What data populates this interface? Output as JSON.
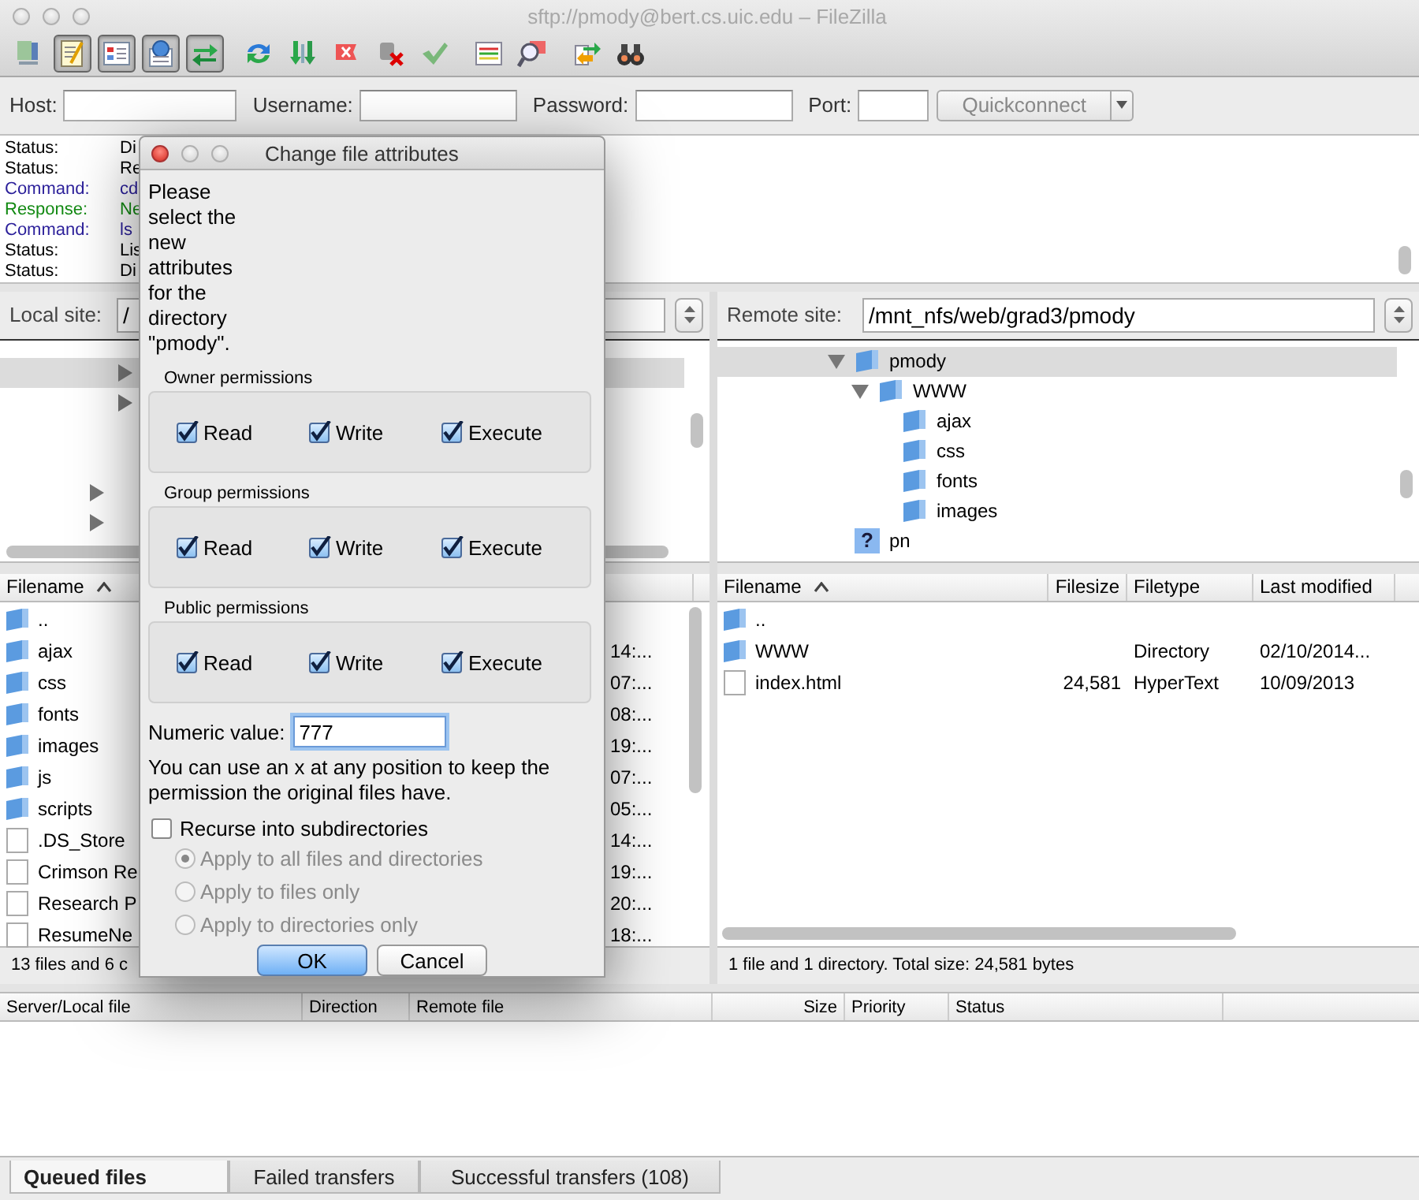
{
  "window": {
    "title": "sftp://pmody@bert.cs.uic.edu – FileZilla"
  },
  "toolbar": [
    {
      "kind": "site-manager",
      "on": false
    },
    {
      "kind": "message-log",
      "on": true
    },
    {
      "kind": "local-tree",
      "on": true
    },
    {
      "kind": "remote-tree",
      "on": true
    },
    {
      "kind": "transfer-queue",
      "on": true
    },
    {
      "kind": "refresh",
      "on": false
    },
    {
      "kind": "process-queue",
      "on": false
    },
    {
      "kind": "cancel",
      "on": false
    },
    {
      "kind": "disconnect",
      "on": false
    },
    {
      "kind": "reconnect",
      "on": false
    },
    {
      "kind": "filter",
      "on": false
    },
    {
      "kind": "compare",
      "on": false
    },
    {
      "kind": "sync",
      "on": false
    },
    {
      "kind": "find",
      "on": false
    }
  ],
  "quickconnect": {
    "fields": [
      {
        "kind": "host",
        "label": "Host:"
      },
      {
        "kind": "username",
        "label": "Username:"
      },
      {
        "kind": "password",
        "label": "Password:"
      },
      {
        "kind": "port",
        "label": "Port:"
      }
    ],
    "button": "Quickconnect"
  },
  "log": [
    {
      "kind": "status",
      "label": "Status:",
      "message": "Di"
    },
    {
      "kind": "status",
      "label": "Status:",
      "message": "Re"
    },
    {
      "kind": "command",
      "label": "Command:",
      "message": "cd"
    },
    {
      "kind": "response",
      "label": "Response:",
      "message": "Ne"
    },
    {
      "kind": "command",
      "label": "Command:",
      "message": "ls"
    },
    {
      "kind": "status",
      "label": "Status:",
      "message": "Lis"
    },
    {
      "kind": "status",
      "label": "Status:",
      "message": "Di"
    }
  ],
  "local": {
    "site_label": "Local site:",
    "path": "/",
    "tree": [
      {
        "expanded": false,
        "selected": true
      },
      {
        "expanded": false,
        "selected": false
      },
      {
        "expanded": false,
        "selected": false
      },
      {
        "expanded": false,
        "selected": false
      }
    ],
    "columns": [
      "Filename"
    ],
    "rows": [
      {
        "kind": "folder",
        "name": ".."
      },
      {
        "kind": "folder",
        "name": "ajax",
        "column_2": "14:..."
      },
      {
        "kind": "folder",
        "name": "css",
        "column_2": "07:..."
      },
      {
        "kind": "folder",
        "name": "fonts",
        "column_2": "08:..."
      },
      {
        "kind": "folder",
        "name": "images",
        "column_2": "19:..."
      },
      {
        "kind": "folder",
        "name": "js",
        "column_2": "07:..."
      },
      {
        "kind": "folder",
        "name": "scripts",
        "column_2": "05:..."
      },
      {
        "kind": "file",
        "name": ".DS_Store",
        "column_2": "14:..."
      },
      {
        "kind": "file",
        "name": "Crimson Re",
        "column_2": "19:..."
      },
      {
        "kind": "file",
        "name": "Research P",
        "column_2": "20:..."
      },
      {
        "kind": "file",
        "name": "ResumeNe",
        "column_2": "18:..."
      }
    ],
    "status": "13 files and 6 c"
  },
  "remote": {
    "site_label": "Remote site:",
    "path": "/mnt_nfs/web/grad3/pmody",
    "tree": [
      {
        "label": "pmody",
        "kind": "folder",
        "expanded": true,
        "selected": true,
        "children": [
          {
            "label": "WWW",
            "kind": "folder",
            "expanded": true,
            "selected": false,
            "children": [
              {
                "label": "ajax",
                "kind": "folder",
                "selected": false
              },
              {
                "label": "css",
                "kind": "folder",
                "selected": false
              },
              {
                "label": "fonts",
                "kind": "folder",
                "selected": false
              },
              {
                "label": "images",
                "kind": "folder",
                "selected": false
              }
            ]
          }
        ]
      },
      {
        "label": "pn",
        "kind": "unknown",
        "badge": "?",
        "selected": false
      }
    ],
    "columns": [
      "Filename",
      "Filesize",
      "Filetype",
      "Last modified"
    ],
    "rows": [
      {
        "kind": "folder",
        "name": ".."
      },
      {
        "kind": "folder",
        "name": "WWW",
        "type": "Directory",
        "modified": "02/10/2014..."
      },
      {
        "kind": "file",
        "name": "index.html",
        "size": "24,581",
        "type": "HyperText",
        "modified": "10/09/2013"
      }
    ],
    "status": "1 file and 1 directory. Total size: 24,581 bytes"
  },
  "queue": {
    "columns": [
      "Server/Local file",
      "Direction",
      "Remote file",
      "Size",
      "Priority",
      "Status"
    ],
    "tabs": [
      {
        "label": "Queued files",
        "selected": true
      },
      {
        "label": "Failed transfers",
        "selected": false
      },
      {
        "label": "Successful transfers (108)",
        "selected": false
      }
    ]
  },
  "dialog": {
    "title": "Change file attributes",
    "message": "Please select the new attributes for the directory \"pmody\".",
    "groups": [
      {
        "title": "Owner permissions",
        "options": [
          {
            "label": "Read",
            "checked": true
          },
          {
            "label": "Write",
            "checked": true
          },
          {
            "label": "Execute",
            "checked": true
          }
        ]
      },
      {
        "title": "Group permissions",
        "options": [
          {
            "label": "Read",
            "checked": true
          },
          {
            "label": "Write",
            "checked": true
          },
          {
            "label": "Execute",
            "checked": true
          }
        ]
      },
      {
        "title": "Public permissions",
        "options": [
          {
            "label": "Read",
            "checked": true
          },
          {
            "label": "Write",
            "checked": true
          },
          {
            "label": "Execute",
            "checked": true
          }
        ]
      }
    ],
    "numeric": {
      "label": "Numeric value:",
      "value": "777",
      "focused": true
    },
    "hint": "You can use an x at any position to keep the permission the original files have.",
    "recurse": {
      "label": "Recurse into subdirectories",
      "checked": false
    },
    "apply": [
      {
        "label": "Apply to all files and directories",
        "selected": true,
        "disabled": true
      },
      {
        "label": "Apply to files only",
        "selected": false,
        "disabled": true
      },
      {
        "label": "Apply to directories only",
        "selected": false,
        "disabled": true
      }
    ],
    "buttons": [
      {
        "label": "OK",
        "default": true
      },
      {
        "label": "Cancel",
        "default": false
      }
    ]
  }
}
